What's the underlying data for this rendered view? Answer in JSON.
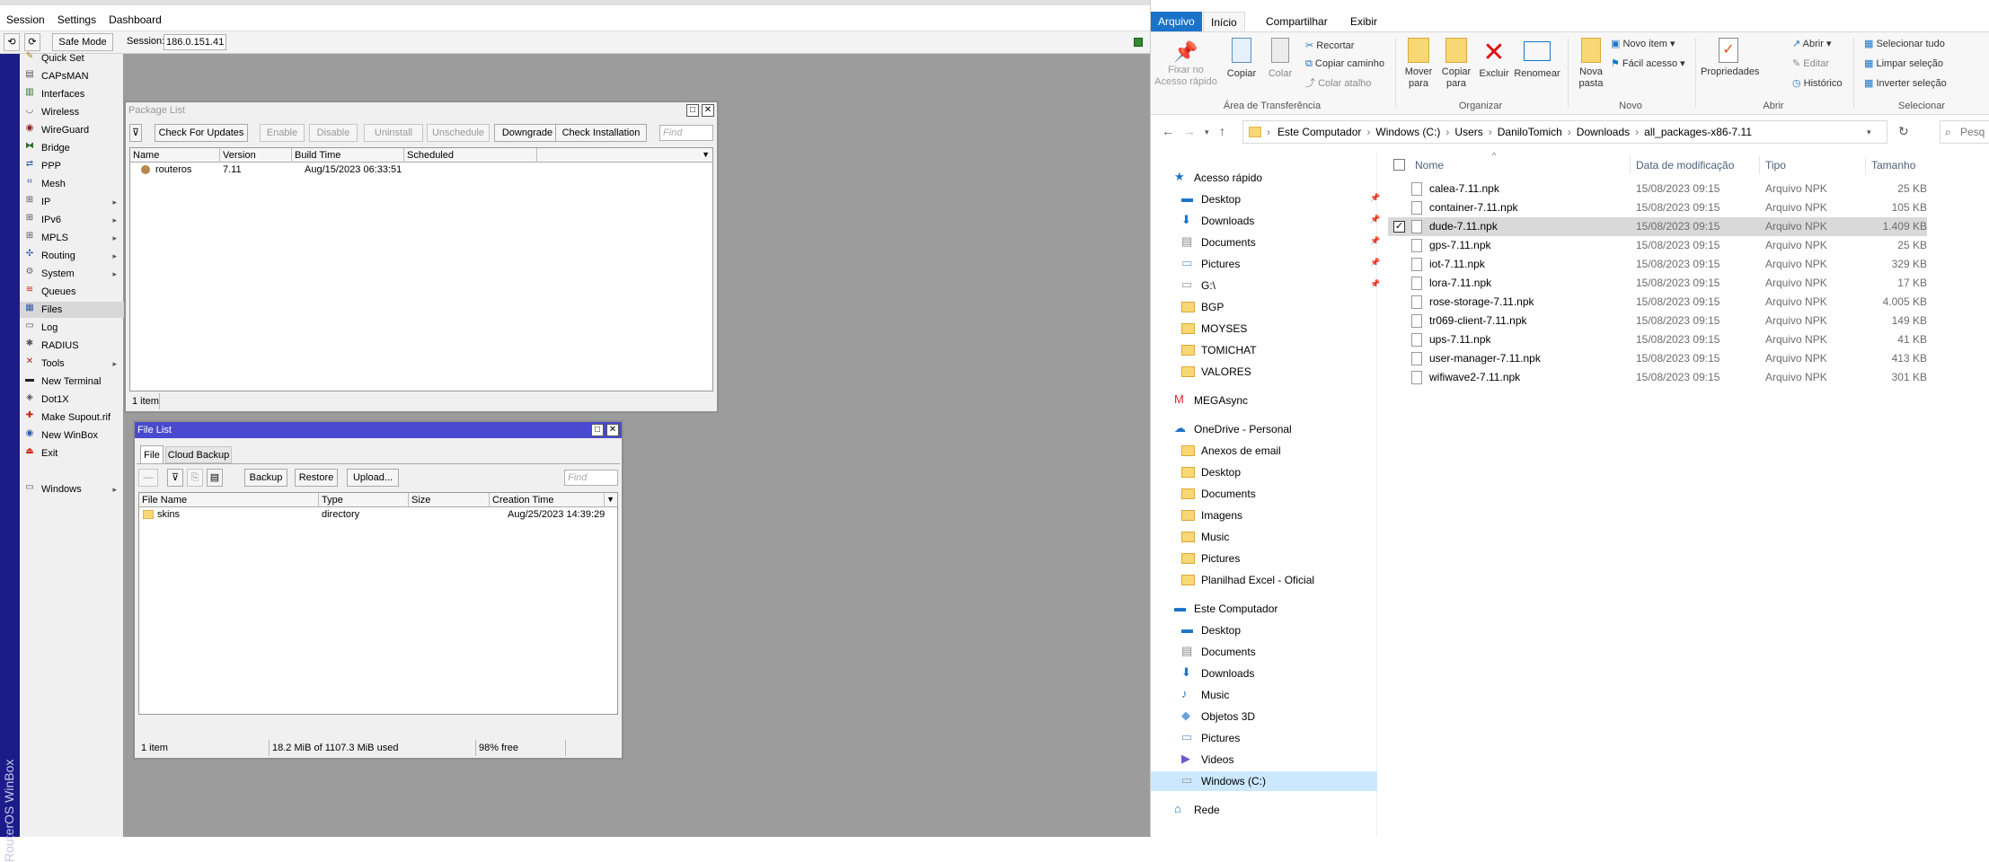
{
  "winbox": {
    "menu": [
      "Session",
      "Settings",
      "Dashboard"
    ],
    "toolbar": {
      "undo_icon": "undo-icon",
      "redo_icon": "redo-icon",
      "safe_mode": "Safe Mode",
      "session_label": "Session:",
      "session_value": "186.0.151.41"
    },
    "vertical_brand": "RouterOS WinBox",
    "sidebar": [
      {
        "label": "Quick Set",
        "icon": "wand-icon",
        "submenu": false
      },
      {
        "label": "CAPsMAN",
        "icon": "capsman-icon",
        "submenu": false
      },
      {
        "label": "Interfaces",
        "icon": "interfaces-icon",
        "submenu": false
      },
      {
        "label": "Wireless",
        "icon": "wireless-icon",
        "submenu": false
      },
      {
        "label": "WireGuard",
        "icon": "wireguard-icon",
        "submenu": false
      },
      {
        "label": "Bridge",
        "icon": "bridge-icon",
        "submenu": false
      },
      {
        "label": "PPP",
        "icon": "ppp-icon",
        "submenu": false
      },
      {
        "label": "Mesh",
        "icon": "mesh-icon",
        "submenu": false
      },
      {
        "label": "IP",
        "icon": "ip-icon",
        "submenu": true
      },
      {
        "label": "IPv6",
        "icon": "ipv6-icon",
        "submenu": true
      },
      {
        "label": "MPLS",
        "icon": "mpls-icon",
        "submenu": true
      },
      {
        "label": "Routing",
        "icon": "routing-icon",
        "submenu": true
      },
      {
        "label": "System",
        "icon": "system-icon",
        "submenu": true
      },
      {
        "label": "Queues",
        "icon": "queues-icon",
        "submenu": false
      },
      {
        "label": "Files",
        "icon": "files-icon",
        "submenu": false
      },
      {
        "label": "Log",
        "icon": "log-icon",
        "submenu": false
      },
      {
        "label": "RADIUS",
        "icon": "radius-icon",
        "submenu": false
      },
      {
        "label": "Tools",
        "icon": "tools-icon",
        "submenu": true
      },
      {
        "label": "New Terminal",
        "icon": "terminal-icon",
        "submenu": false
      },
      {
        "label": "Dot1X",
        "icon": "dot1x-icon",
        "submenu": false
      },
      {
        "label": "Make Supout.rif",
        "icon": "supout-icon",
        "submenu": false
      },
      {
        "label": "New WinBox",
        "icon": "winbox-icon",
        "submenu": false
      },
      {
        "label": "Exit",
        "icon": "exit-icon",
        "submenu": false
      },
      {
        "label": "Windows",
        "icon": "windows-icon",
        "submenu": true
      }
    ],
    "package_list": {
      "title": "Package List",
      "buttons": [
        "Check For Updates",
        "Enable",
        "Disable",
        "Uninstall",
        "Unschedule",
        "Downgrade",
        "Check Installation"
      ],
      "find_placeholder": "Find",
      "columns": [
        "Name",
        "Version",
        "Build Time",
        "Scheduled"
      ],
      "rows": [
        {
          "name": "routeros",
          "version": "7.11",
          "build_time": "Aug/15/2023 06:33:51",
          "scheduled": ""
        }
      ],
      "status": "1 item"
    },
    "file_list": {
      "title": "File List",
      "tabs": [
        "File",
        "Cloud Backup"
      ],
      "buttons": [
        "Backup",
        "Restore",
        "Upload..."
      ],
      "find_placeholder": "Find",
      "columns": [
        "File Name",
        "Type",
        "Size",
        "Creation Time"
      ],
      "rows": [
        {
          "name": "skins",
          "type": "directory",
          "size": "",
          "created": "Aug/25/2023 14:39:29"
        }
      ],
      "status": [
        "1 item",
        "18.2 MiB of 1107.3 MiB used",
        "98% free"
      ]
    }
  },
  "explorer": {
    "ribbon_tabs": [
      "Arquivo",
      "Início",
      "Compartilhar",
      "Exibir"
    ],
    "ribbon": {
      "pin": "Fixar no Acesso rápido",
      "copy": "Copiar",
      "paste": "Colar",
      "cut": "Recortar",
      "copy_path": "Copiar caminho",
      "paste_shortcut": "Colar atalho",
      "group_clipboard": "Área de Transferência",
      "move_to": "Mover para",
      "copy_to": "Copiar para",
      "delete": "Excluir",
      "rename": "Renomear",
      "group_organize": "Organizar",
      "new_folder": "Nova pasta",
      "new_item": "Novo item",
      "easy_access": "Fácil acesso",
      "group_new": "Novo",
      "properties": "Propriedades",
      "open": "Abrir",
      "edit": "Editar",
      "history": "Histórico",
      "group_open": "Abrir",
      "select_all": "Selecionar tudo",
      "select_none": "Limpar seleção",
      "invert": "Inverter seleção",
      "group_select": "Selecionar"
    },
    "breadcrumb": [
      "Este Computador",
      "Windows (C:)",
      "Users",
      "DaniloTomich",
      "Downloads",
      "all_packages-x86-7.11"
    ],
    "search_placeholder": "Pesq",
    "nav": [
      {
        "label": "Acesso rápido",
        "level": 0,
        "icon": "star-icon",
        "pinned": false
      },
      {
        "label": "Desktop",
        "level": 1,
        "icon": "desktop-icon",
        "pinned": true
      },
      {
        "label": "Downloads",
        "level": 1,
        "icon": "downloads-icon",
        "pinned": true
      },
      {
        "label": "Documents",
        "level": 1,
        "icon": "documents-icon",
        "pinned": true
      },
      {
        "label": "Pictures",
        "level": 1,
        "icon": "pictures-icon",
        "pinned": true
      },
      {
        "label": "G:\\",
        "level": 1,
        "icon": "drive-icon",
        "pinned": true
      },
      {
        "label": "BGP",
        "level": 1,
        "icon": "folder-icon",
        "pinned": false
      },
      {
        "label": "MOYSES",
        "level": 1,
        "icon": "folder-icon",
        "pinned": false
      },
      {
        "label": "TOMICHAT",
        "level": 1,
        "icon": "folder-icon",
        "pinned": false
      },
      {
        "label": "VALORES",
        "level": 1,
        "icon": "folder-icon",
        "pinned": false
      },
      {
        "label": "MEGAsync",
        "level": 0,
        "icon": "mega-icon",
        "pinned": false
      },
      {
        "label": "OneDrive - Personal",
        "level": 0,
        "icon": "onedrive-icon",
        "pinned": false
      },
      {
        "label": "Anexos de email",
        "level": 1,
        "icon": "folder-icon",
        "pinned": false
      },
      {
        "label": "Desktop",
        "level": 1,
        "icon": "folder-icon",
        "pinned": false
      },
      {
        "label": "Documents",
        "level": 1,
        "icon": "folder-icon",
        "pinned": false
      },
      {
        "label": "Imagens",
        "level": 1,
        "icon": "folder-icon",
        "pinned": false
      },
      {
        "label": "Music",
        "level": 1,
        "icon": "folder-icon",
        "pinned": false
      },
      {
        "label": "Pictures",
        "level": 1,
        "icon": "folder-icon",
        "pinned": false
      },
      {
        "label": "Planilhad Excel - Oficial",
        "level": 1,
        "icon": "folder-icon",
        "pinned": false
      },
      {
        "label": "Este Computador",
        "level": 0,
        "icon": "computer-icon",
        "pinned": false
      },
      {
        "label": "Desktop",
        "level": 1,
        "icon": "desktop-icon",
        "pinned": false
      },
      {
        "label": "Documents",
        "level": 1,
        "icon": "documents-icon",
        "pinned": false
      },
      {
        "label": "Downloads",
        "level": 1,
        "icon": "downloads-icon",
        "pinned": false
      },
      {
        "label": "Music",
        "level": 1,
        "icon": "music-icon",
        "pinned": false
      },
      {
        "label": "Objetos 3D",
        "level": 1,
        "icon": "objects3d-icon",
        "pinned": false
      },
      {
        "label": "Pictures",
        "level": 1,
        "icon": "pictures-icon",
        "pinned": false
      },
      {
        "label": "Videos",
        "level": 1,
        "icon": "videos-icon",
        "pinned": false
      },
      {
        "label": "Windows (C:)",
        "level": 1,
        "icon": "drive-icon",
        "pinned": false,
        "selected": true
      },
      {
        "label": "Rede",
        "level": 0,
        "icon": "network-icon",
        "pinned": false
      }
    ],
    "columns": [
      "Nome",
      "Data de modificação",
      "Tipo",
      "Tamanho"
    ],
    "files": [
      {
        "name": "calea-7.11.npk",
        "date": "15/08/2023 09:15",
        "type": "Arquivo NPK",
        "size": "25 KB"
      },
      {
        "name": "container-7.11.npk",
        "date": "15/08/2023 09:15",
        "type": "Arquivo NPK",
        "size": "105 KB"
      },
      {
        "name": "dude-7.11.npk",
        "date": "15/08/2023 09:15",
        "type": "Arquivo NPK",
        "size": "1.409 KB",
        "selected": true
      },
      {
        "name": "gps-7.11.npk",
        "date": "15/08/2023 09:15",
        "type": "Arquivo NPK",
        "size": "25 KB"
      },
      {
        "name": "iot-7.11.npk",
        "date": "15/08/2023 09:15",
        "type": "Arquivo NPK",
        "size": "329 KB"
      },
      {
        "name": "lora-7.11.npk",
        "date": "15/08/2023 09:15",
        "type": "Arquivo NPK",
        "size": "17 KB"
      },
      {
        "name": "rose-storage-7.11.npk",
        "date": "15/08/2023 09:15",
        "type": "Arquivo NPK",
        "size": "4.005 KB"
      },
      {
        "name": "tr069-client-7.11.npk",
        "date": "15/08/2023 09:15",
        "type": "Arquivo NPK",
        "size": "149 KB"
      },
      {
        "name": "ups-7.11.npk",
        "date": "15/08/2023 09:15",
        "type": "Arquivo NPK",
        "size": "41 KB"
      },
      {
        "name": "user-manager-7.11.npk",
        "date": "15/08/2023 09:15",
        "type": "Arquivo NPK",
        "size": "413 KB"
      },
      {
        "name": "wifiwave2-7.11.npk",
        "date": "15/08/2023 09:15",
        "type": "Arquivo NPK",
        "size": "301 KB"
      }
    ]
  }
}
